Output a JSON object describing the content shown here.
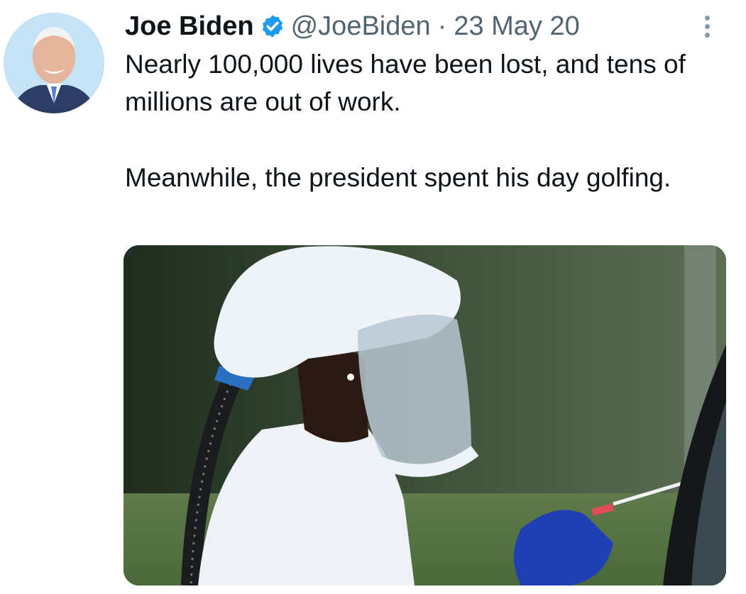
{
  "tweet": {
    "author_name": "Joe Biden",
    "handle": "@JoeBiden",
    "separator": "·",
    "date": "23 May 20",
    "text_paragraph_1": "Nearly 100,000 lives have been lost, and tens of millions are out of work.",
    "text_paragraph_2": "Meanwhile, the president spent his day golfing."
  },
  "icons": {
    "verified": "verified-badge-icon",
    "more": "more-vertical-icon"
  },
  "colors": {
    "verified_blue": "#1d9bf0",
    "secondary_text": "#536471",
    "primary_text": "#0f1419"
  }
}
